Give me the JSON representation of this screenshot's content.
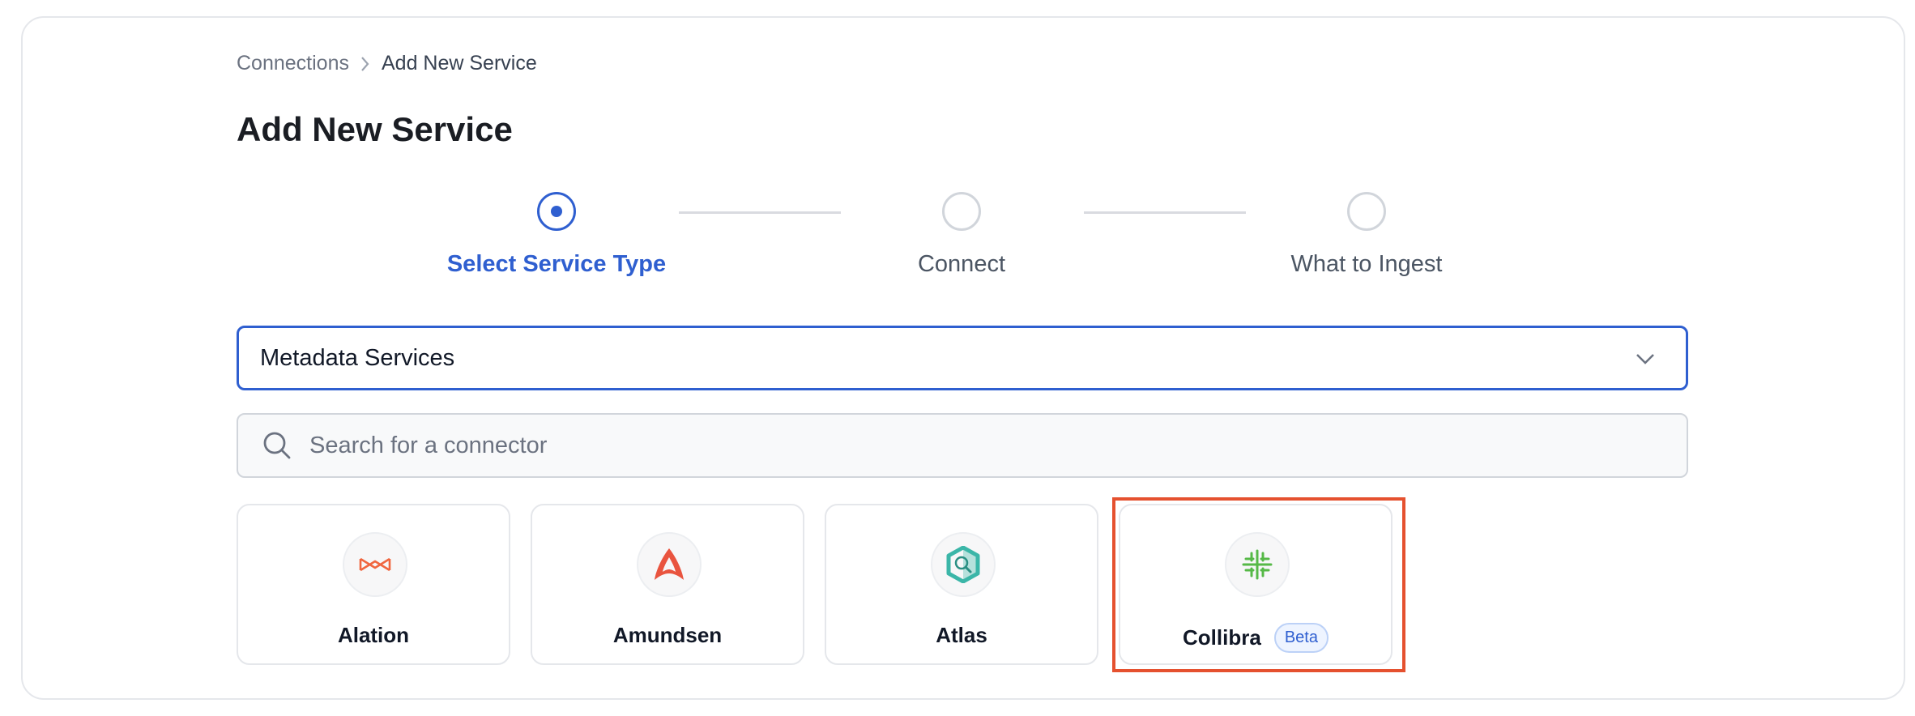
{
  "breadcrumb": {
    "parent": "Connections",
    "current": "Add New Service"
  },
  "page_title": "Add New Service",
  "steps": [
    {
      "label": "Select Service Type",
      "state": "active"
    },
    {
      "label": "Connect",
      "state": "pending"
    },
    {
      "label": "What to Ingest",
      "state": "pending"
    }
  ],
  "service_type_select": {
    "value": "Metadata Services"
  },
  "search": {
    "placeholder": "Search for a connector",
    "value": ""
  },
  "connectors": [
    {
      "name": "Alation",
      "icon": "alation-logo-icon",
      "badge": null
    },
    {
      "name": "Amundsen",
      "icon": "amundsen-logo-icon",
      "badge": null
    },
    {
      "name": "Atlas",
      "icon": "atlas-logo-icon",
      "badge": null
    },
    {
      "name": "Collibra",
      "icon": "collibra-logo-icon",
      "badge": "Beta"
    }
  ],
  "colors": {
    "accent": "#2f5fd0",
    "highlight": "#e5512f",
    "alation": "#f0663f",
    "amundsen": "#e9543f",
    "atlas": "#3bb6a8",
    "collibra": "#56b947"
  }
}
